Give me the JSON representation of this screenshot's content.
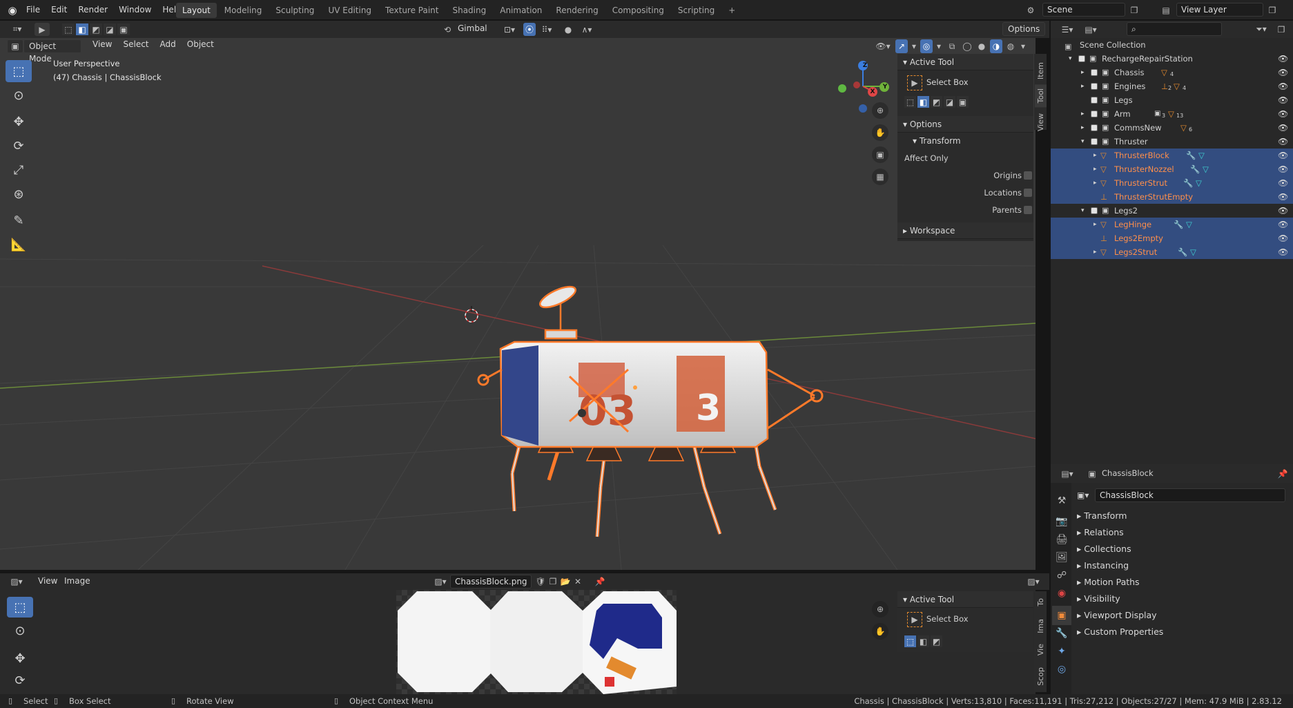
{
  "topbar": {
    "menus": [
      "File",
      "Edit",
      "Render",
      "Window",
      "Help"
    ],
    "workspaces": [
      "Layout",
      "Modeling",
      "Sculpting",
      "UV Editing",
      "Texture Paint",
      "Shading",
      "Animation",
      "Rendering",
      "Compositing",
      "Scripting"
    ],
    "active_workspace": "Layout",
    "scene": "Scene",
    "view_layer": "View Layer"
  },
  "viewport": {
    "mode": "Object Mode",
    "menus": [
      "View",
      "Select",
      "Add",
      "Object"
    ],
    "orientation": "Gimbal",
    "options_label": "Options",
    "overlay_title": "User Perspective",
    "overlay_subtitle": "(47) Chassis | ChassisBlock",
    "gizmo_axes": [
      "Z",
      "Y",
      "X"
    ]
  },
  "npanel": {
    "tabs": [
      "Item",
      "Tool",
      "View"
    ],
    "active_tool_header": "Active Tool",
    "tool_name": "Select Box",
    "options_header": "Options",
    "transform_header": "Transform",
    "affect_only": "Affect Only",
    "origins": "Origins",
    "locations": "Locations",
    "parents": "Parents",
    "workspace_header": "Workspace"
  },
  "outliner": {
    "root": "Scene Collection",
    "rows": [
      {
        "name": "RechargeRepairStation",
        "sel": false
      },
      {
        "name": "Chassis",
        "sel": false
      },
      {
        "name": "Engines",
        "sel": false
      },
      {
        "name": "Legs",
        "sel": false
      },
      {
        "name": "Arm",
        "sel": false
      },
      {
        "name": "CommsNew",
        "sel": false
      },
      {
        "name": "Thruster",
        "sel": false
      },
      {
        "name": "ThrusterBlock",
        "sel": true
      },
      {
        "name": "ThrusterNozzel",
        "sel": true
      },
      {
        "name": "ThrusterStrut",
        "sel": true
      },
      {
        "name": "ThrusterStrutEmpty",
        "sel": true
      },
      {
        "name": "Legs2",
        "sel": false
      },
      {
        "name": "LegHinge",
        "sel": true
      },
      {
        "name": "Legs2Empty",
        "sel": true
      },
      {
        "name": "Legs2Strut",
        "sel": true
      }
    ],
    "badges": {
      "chassis": "4",
      "engines_a": "2",
      "engines_b": "4",
      "arm_a": "3",
      "arm_b": "13",
      "commsnew": "6"
    }
  },
  "properties": {
    "header_object": "ChassisBlock",
    "object_name": "ChassisBlock",
    "sections": [
      "Transform",
      "Relations",
      "Collections",
      "Instancing",
      "Motion Paths",
      "Visibility",
      "Viewport Display",
      "Custom Properties"
    ]
  },
  "image_editor": {
    "menus": [
      "View",
      "Image"
    ],
    "image_name": "ChassisBlock.png",
    "active_tool_header": "Active Tool",
    "tool_name": "Select Box",
    "tabs": [
      "To",
      "Ima",
      "Vie",
      "Scop"
    ]
  },
  "statusbar": {
    "select": "Select",
    "box_select": "Box Select",
    "rotate_view": "Rotate View",
    "context_menu": "Object Context Menu",
    "stats": "Chassis | ChassisBlock | Verts:13,810 | Faces:11,191 | Tris:27,212 | Objects:27/27 | Mem: 47.9 MiB | 2.83.12"
  },
  "colors": {
    "accent": "#4772b3",
    "selection": "#ff8f4a",
    "outliner_sel": "#334d80",
    "viewport": "#393939"
  }
}
